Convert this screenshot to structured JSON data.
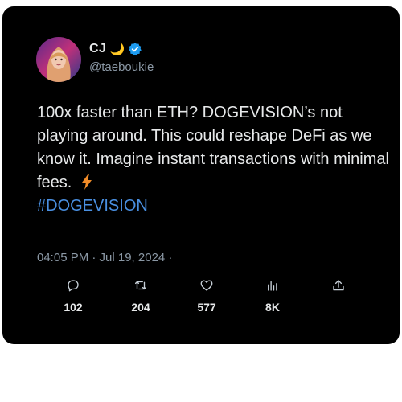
{
  "user": {
    "display_name": "CJ",
    "moon_emoji": "🌙",
    "handle": "@taeboukie",
    "verified": true
  },
  "tweet": {
    "text": "100x faster than ETH? DOGEVISION’s not playing around. This could reshape DeFi as we know it. Imagine instant transactions with minimal fees.",
    "emoji": "lightning-bolt-icon",
    "hashtag": "#DOGEVISION",
    "timestamp": "04:05 PM · Jul 19, 2024 ·"
  },
  "actions": {
    "replies": "102",
    "retweets": "204",
    "likes": "577",
    "views": "8K"
  },
  "colors": {
    "background": "#000000",
    "text": "#e7e9ea",
    "muted": "#8b98a5",
    "hashtag": "#4a90e2",
    "verified": "#1d9bf0",
    "bolt": "#f28c28"
  }
}
